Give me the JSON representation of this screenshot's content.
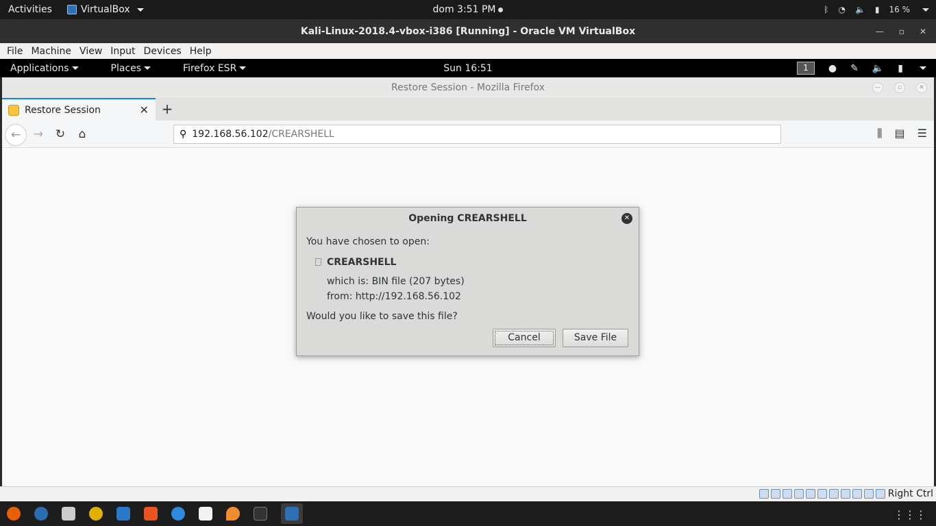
{
  "host_topbar": {
    "activities": "Activities",
    "app_menu": "VirtualBox",
    "clock": "dom  3:51 PM",
    "battery": "16 %"
  },
  "vbox": {
    "title": "Kali-Linux-2018.4-vbox-i386 [Running] - Oracle VM VirtualBox",
    "menu": [
      "File",
      "Machine",
      "View",
      "Input",
      "Devices",
      "Help"
    ],
    "host_key": "Right Ctrl"
  },
  "kali_bar": {
    "applications": "Applications",
    "places": "Places",
    "firefox": "Firefox ESR",
    "clock": "Sun 16:51",
    "workspace": "1"
  },
  "firefox": {
    "window_title": "Restore Session - Mozilla Firefox",
    "tab_label": "Restore Session",
    "new_tab": "+",
    "url_host": "192.168.56.102",
    "url_path": "/CREARSHELL"
  },
  "dialog": {
    "title": "Opening CREARSHELL",
    "intro": "You have chosen to open:",
    "filename": "CREARSHELL",
    "which_is": "which is:  BIN file (207 bytes)",
    "from": "from:  http://192.168.56.102",
    "question": "Would you like to save this file?",
    "cancel": "Cancel",
    "save": "Save File"
  },
  "colors": {
    "tab_accent": "#0a84ff",
    "dialog_bg": "#dadad8",
    "vbox_blue": "#2f6fb5"
  }
}
